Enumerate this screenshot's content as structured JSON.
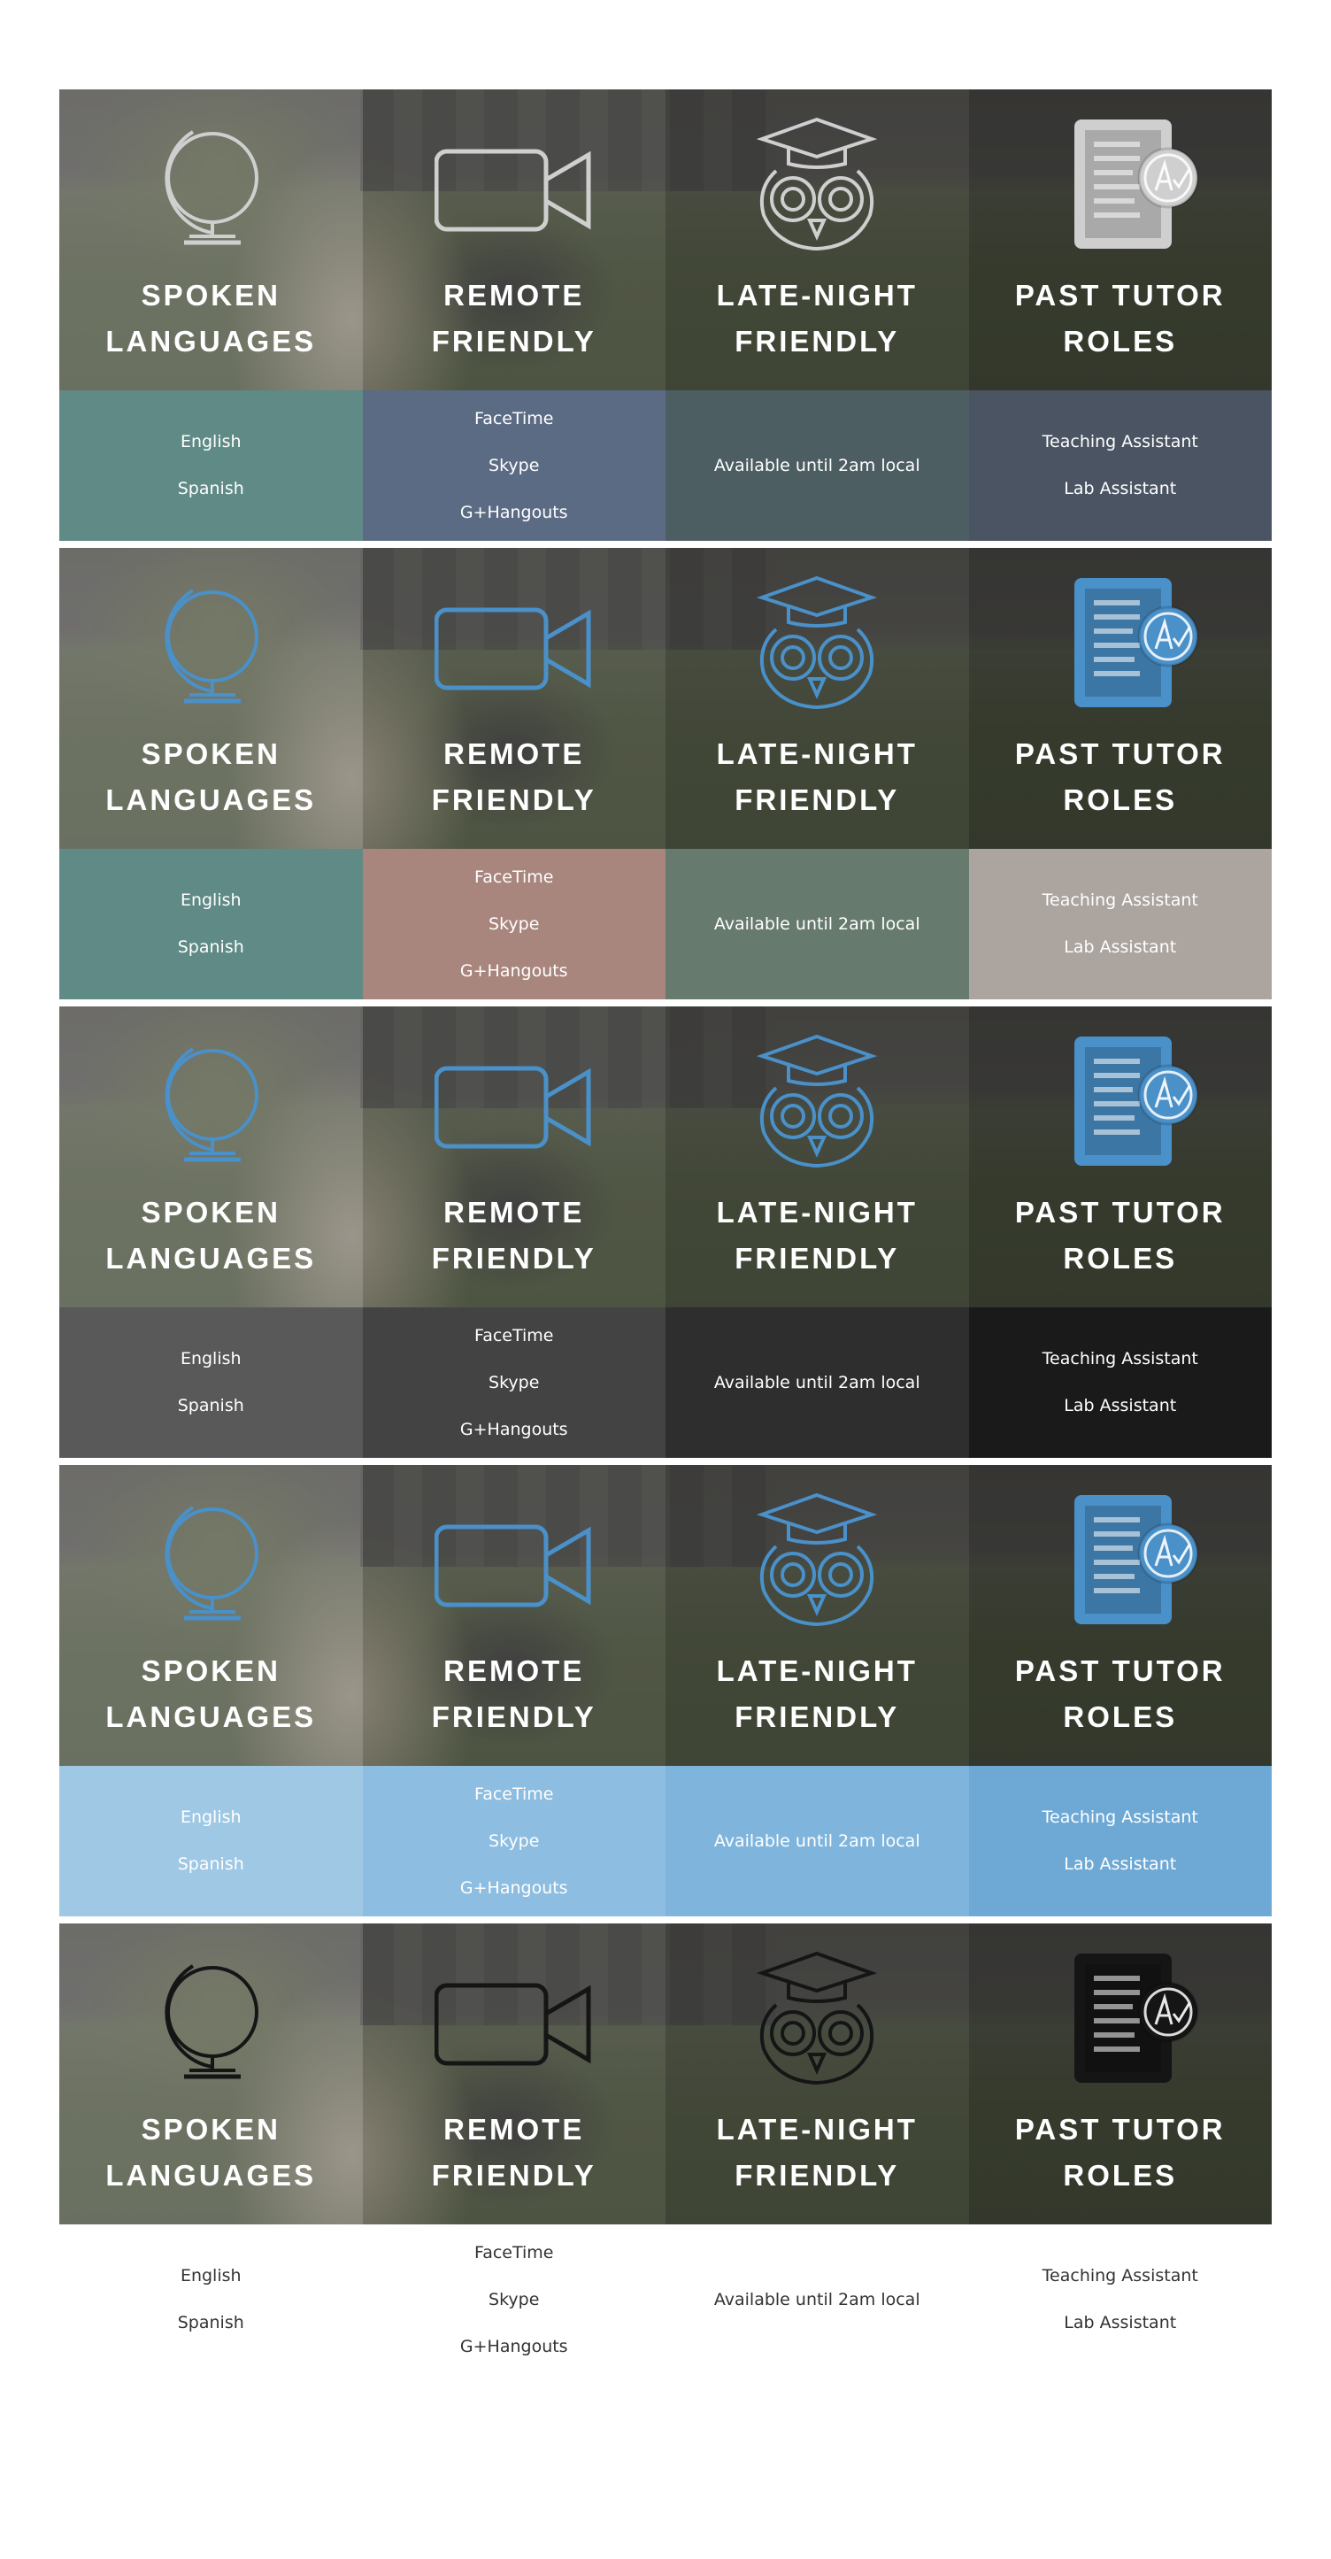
{
  "tiles": [
    {
      "icon": "globe-icon",
      "label_line1": "SPOKEN",
      "label_line2": "LANGUAGES",
      "items": [
        "English",
        "Spanish"
      ]
    },
    {
      "icon": "video-camera-icon",
      "label_line1": "REMOTE",
      "label_line2": "FRIENDLY",
      "items": [
        "FaceTime",
        "Skype",
        "G+Hangouts"
      ]
    },
    {
      "icon": "owl-icon",
      "label_line1": "LATE-NIGHT",
      "label_line2": "FRIENDLY",
      "items": [
        "Available until 2am local"
      ]
    },
    {
      "icon": "graded-document-icon",
      "label_line1": "PAST TUTOR",
      "label_line2": "ROLES",
      "items": [
        "Teaching Assistant",
        "Lab Assistant"
      ]
    }
  ],
  "variants": [
    {
      "icon_color": "#cfcfcf",
      "detail_text_color": "#ffffff",
      "detail_colors": [
        "#5f8a85",
        "#5c6b84",
        "#4d5e63",
        "#4b5463"
      ]
    },
    {
      "icon_color": "#4a90c9",
      "detail_text_color": "#ffffff",
      "detail_colors": [
        "#5f8a85",
        "#a8857d",
        "#677a6e",
        "#aba49f"
      ]
    },
    {
      "icon_color": "#4a90c9",
      "detail_text_color": "#ffffff",
      "detail_colors": [
        "#595959",
        "#434343",
        "#2e2e2e",
        "#1a1a1a"
      ]
    },
    {
      "icon_color": "#4a90c9",
      "detail_text_color": "#ffffff",
      "detail_colors": [
        "#9fc8e4",
        "#8dbde0",
        "#7fb5dc",
        "#6ea9d6"
      ]
    },
    {
      "icon_color": "#151515",
      "detail_text_color": "#333333",
      "detail_colors": [
        "#ffffff",
        "#ffffff",
        "#ffffff",
        "#ffffff"
      ]
    }
  ]
}
